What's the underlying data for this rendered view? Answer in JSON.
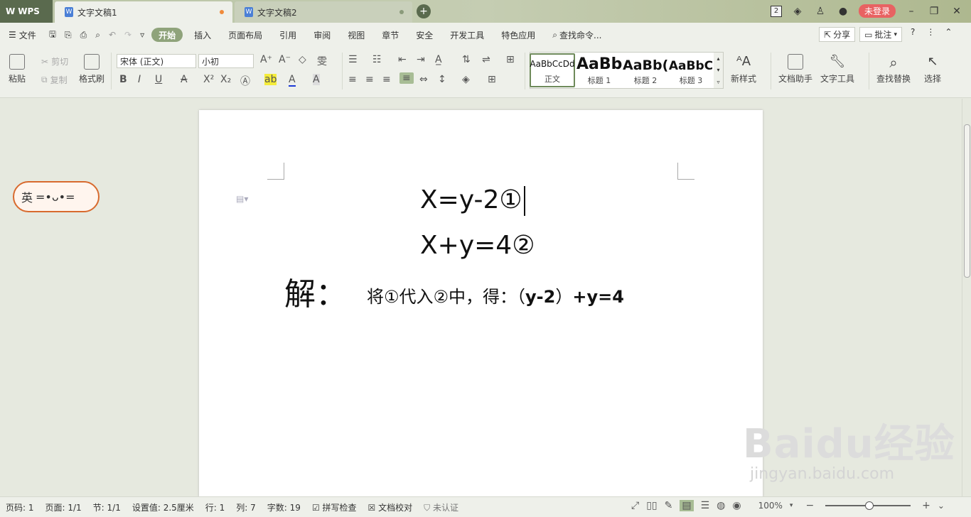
{
  "tabbar": {
    "app_label": "WPS",
    "tabs": [
      {
        "label": "文字文稿1"
      },
      {
        "label": "文字文稿2"
      }
    ],
    "badge_count": "2",
    "login_label": "未登录"
  },
  "menu": {
    "file": "文件",
    "items": [
      "开始",
      "插入",
      "页面布局",
      "引用",
      "审阅",
      "视图",
      "章节",
      "安全",
      "开发工具",
      "特色应用"
    ],
    "search_placeholder": "查找命令...",
    "share": "分享",
    "comment": "批注"
  },
  "ribbon": {
    "paste": "粘贴",
    "cut": "剪切",
    "copy": "复制",
    "format_painter": "格式刷",
    "font_name": "宋体 (正文)",
    "font_size": "小初",
    "styles": [
      {
        "sample": "AaBbCcDd",
        "name": "正文"
      },
      {
        "sample": "AaBb",
        "name": "标题 1"
      },
      {
        "sample": "AaBb(",
        "name": "标题 2"
      },
      {
        "sample": "AaBbC",
        "name": "标题 3"
      }
    ],
    "new_style": "新样式",
    "doc_assistant": "文档助手",
    "text_tools": "文字工具",
    "find_replace": "查找替换",
    "select": "选择"
  },
  "document": {
    "line1": "X=y-2①",
    "line2": "X+y=4②",
    "solution_label": "解：",
    "solution_text_a": "将①代入②中，得：（",
    "solution_text_b": "y-2",
    "solution_text_c": "）",
    "solution_text_d": "+y=4"
  },
  "sticker": {
    "text": "英",
    "face": "=•ᴗ•="
  },
  "watermark": {
    "brand": "Baidu经验",
    "url": "jingyan.baidu.com"
  },
  "status": {
    "page_no": "页码: 1",
    "pages": "页面: 1/1",
    "section": "节: 1/1",
    "setting": "设置值: 2.5厘米",
    "row": "行: 1",
    "col": "列: 7",
    "words": "字数: 19",
    "spell": "拼写检查",
    "proof": "文档校对",
    "cert": "未认证",
    "zoom": "100%"
  }
}
